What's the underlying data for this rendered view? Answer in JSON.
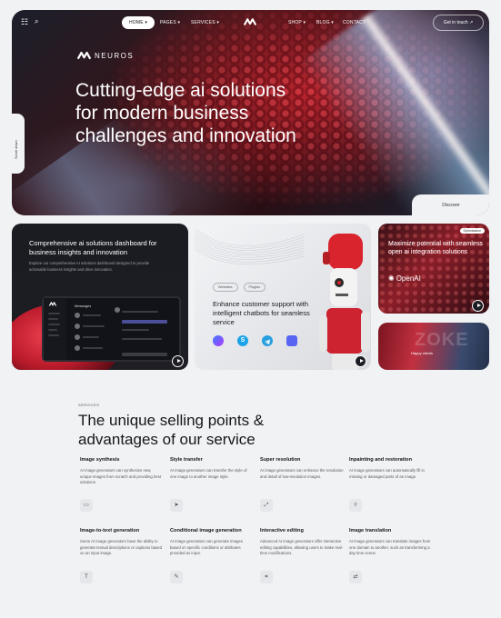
{
  "nav": {
    "items": [
      "HOME",
      "PAGES",
      "SERVICES",
      "SHOP",
      "BLOG",
      "CONTACT"
    ],
    "cta": "Get in touch"
  },
  "hero": {
    "brand": "NEUROS",
    "headline": "Cutting-edge ai solutions for modern business challenges and innovation",
    "scroll_label": "Scroll down",
    "discover": "Discover"
  },
  "cards": {
    "dashboard": {
      "title": "Comprehensive ai solutions dashboard for business insights and innovation",
      "desc": "Explore our comprehensive AI solutions dashboard designed to provide actionable business insights and drive innovation.",
      "screen_title": "Messages"
    },
    "chatbot": {
      "tags": [
        "Websites",
        "Plugins"
      ],
      "title": "Enhance customer support with intelligent chatbots for seamless service"
    },
    "openai": {
      "badge": "Optimization",
      "title": "Maximize potential with seamless open ai integration solutions",
      "logo": "OpenAI"
    },
    "promo": {
      "big": "ZOKE",
      "small": "Happy clients"
    }
  },
  "services": {
    "eyebrow": "SERVICES",
    "title": "The unique selling points & advantages of our service",
    "items": [
      {
        "title": "Image synthesis",
        "desc": "AI image generators can synthesize new, unique images from scratch and providing best solutions.",
        "icon": "image-icon"
      },
      {
        "title": "Style transfer",
        "desc": "AI image generators can transfer the style of one image to another image style.",
        "icon": "send-icon"
      },
      {
        "title": "Super resolution",
        "desc": "AI image generators can enhance the resolution and detail of low-resolution images.",
        "icon": "resize-icon"
      },
      {
        "title": "Inpainting and restoration",
        "desc": "AI image generators can automatically fill in missing or damaged parts of an image.",
        "icon": "drop-icon"
      },
      {
        "title": "Image-to-text generation",
        "desc": "Some AI image generators have the ability to generate textual descriptions or captions based on an input image.",
        "icon": "text-icon"
      },
      {
        "title": "Conditional image generation",
        "desc": "AI image generators can generate images based on specific conditions or attributes provided as input.",
        "icon": "edit-icon"
      },
      {
        "title": "Interactive editing",
        "desc": "Advanced AI image generators offer interactive editing capabilities, allowing users to make real-time modifications.",
        "icon": "crop-icon"
      },
      {
        "title": "Image translation",
        "desc": "AI image generators can translate images from one domain to another, such as transforming a day time scene.",
        "icon": "translate-icon"
      }
    ]
  }
}
